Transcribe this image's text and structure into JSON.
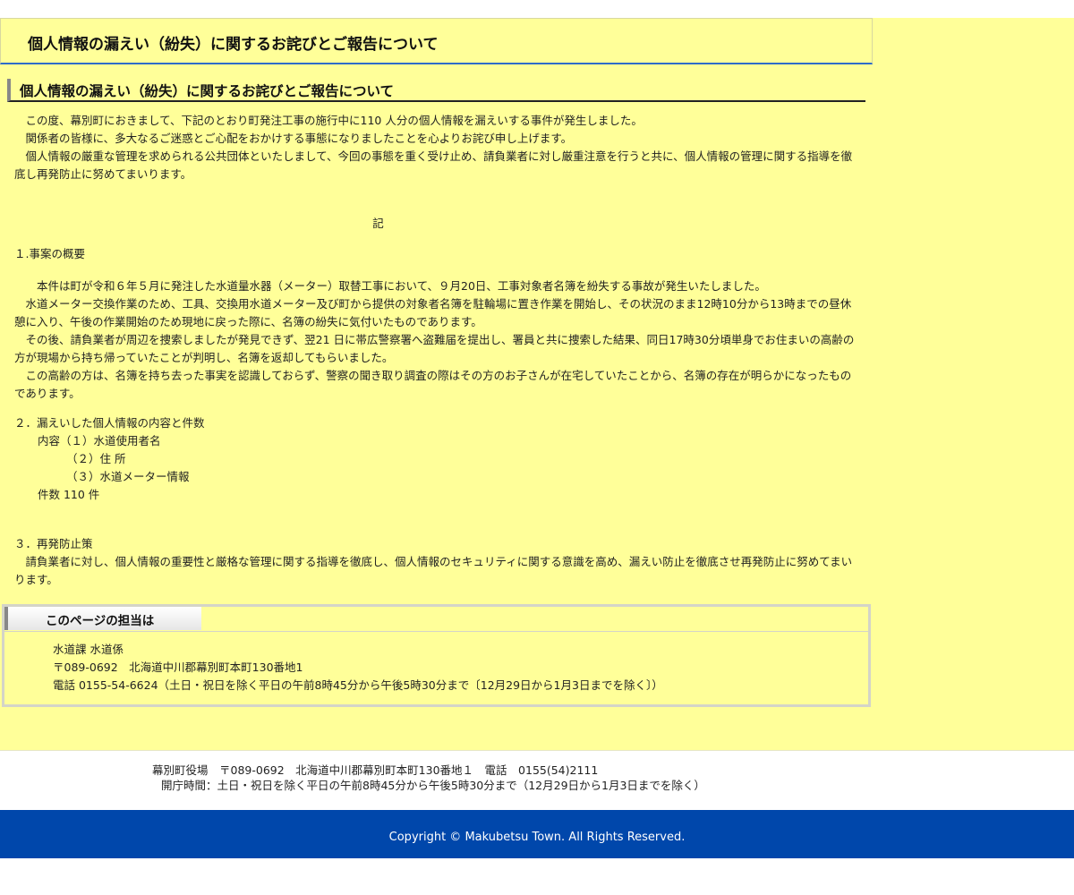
{
  "header": {
    "title": "個人情報の漏えい（紛失）に関するお詫びとご報告について"
  },
  "content": {
    "heading": "個人情報の漏えい（紛失）に関するお詫びとご報告について",
    "intro": [
      "この度、幕別町におきまして、下記のとおり町発注工事の施行中に110 人分の個人情報を漏えいする事件が発生しました。",
      "関係者の皆様に、多大なるご迷惑とご心配をおかけする事態になりましたことを心よりお詫び申し上げます。",
      "個人情報の厳重な管理を求められる公共団体といたしまして、今回の事態を重く受け止め、請負業者に対し厳重注意を行うと共に、個人情報の管理に関する指導を徹底し再発防止に努めてまいります。"
    ],
    "note_mark": "記",
    "section1": {
      "title": "１.事案の概要",
      "paragraphs": [
        "本件は町が令和６年５月に発注した水道量水器（メーター）取替工事において、９月20日、工事対象者名簿を紛失する事故が発生いたしました。",
        "水道メーター交換作業のため、工具、交換用水道メーター及び町から提供の対象者名簿を駐輪場に置き作業を開始し、その状況のまま12時10分から13時までの昼休憩に入り、午後の作業開始のため現地に戻った際に、名簿の紛失に気付いたものであります。",
        "その後、請負業者が周辺を捜索しましたが発見できず、翌21 日に帯広警察署へ盗難届を提出し、署員と共に捜索した結果、同日17時30分頃単身でお住まいの高齢の方が現場から持ち帰っていたことが判明し、名簿を返却してもらいました。",
        "この高齢の方は、名簿を持ち去った事実を認識しておらず、警察の聞き取り調査の際はその方のお子さんが在宅していたことから、名簿の存在が明らかになったものであります。"
      ]
    },
    "section2": {
      "title": "２．漏えいした個人情報の内容と件数",
      "lines": [
        "内容（１）水道使用者名",
        "（２）住 所",
        "（３）水道メーター情報",
        "件数 110 件"
      ]
    },
    "section3": {
      "title": "３．再発防止策",
      "paragraph": "請負業者に対し、個人情報の重要性と厳格な管理に関する指導を徹底し、個人情報のセキュリティに関する意識を高め、漏えい防止を徹底させ再発防止に努めてまいります。"
    }
  },
  "contact": {
    "title": "このページの担当は",
    "department": "水道課 水道係",
    "address": "〒089-0692　北海道中川郡幕別町本町130番地1",
    "phone": "電話 0155-54-6624（土日・祝日を除く平日の午前8時45分から午後5時30分まで〔12月29日から1月3日までを除く〕）"
  },
  "footer": {
    "line1": "幕別町役場　〒089-0692　北海道中川郡幕別町本町130番地１　電話　0155(54)2111",
    "line2": "開庁時間：土日・祝日を除く平日の午前8時45分から午後5時30分まで（12月29日から1月3日までを除く）",
    "copyright": "Copyright © Makubetsu Town. All Rights Reserved."
  },
  "colors": {
    "page_background": "#ffff99",
    "header_rule": "#2e6cc9",
    "copyright_bar": "#0047ab"
  }
}
